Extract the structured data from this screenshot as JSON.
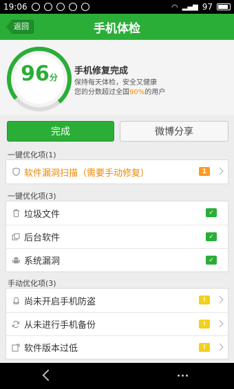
{
  "status_bar": {
    "time": "19:06",
    "battery": "97"
  },
  "title_bar": {
    "back_label": "返回",
    "title": "手机体检"
  },
  "score": {
    "value": "96",
    "unit": "分",
    "fraction": 0.96,
    "headline": "手机修复完成",
    "line1": "保持每天体检，安全又健康",
    "line2_prefix": "您的分数超过全国",
    "line2_pct": "90%",
    "line2_suffix": "的用户"
  },
  "buttons": {
    "done": "完成",
    "share": "微博分享"
  },
  "sections": [
    {
      "title": "一键优化项(1)",
      "items": [
        {
          "label": "软件漏洞扫描（需要手动修复）",
          "icon": "shield-icon",
          "badge": "1",
          "badge_type": "orange",
          "warn": true,
          "chevron": true
        }
      ]
    },
    {
      "title": "一键优化项(3)",
      "items": [
        {
          "label": "垃圾文件",
          "icon": "trash-icon",
          "badge": "✓",
          "badge_type": "check",
          "chevron": false
        },
        {
          "label": "后台软件",
          "icon": "windows-icon",
          "badge": "✓",
          "badge_type": "check",
          "chevron": false
        },
        {
          "label": "系统漏洞",
          "icon": "android-icon",
          "badge": "✓",
          "badge_type": "check",
          "chevron": false
        }
      ]
    },
    {
      "title": "手动优化项(3)",
      "items": [
        {
          "label": "尚未开启手机防盗",
          "icon": "alarm-icon",
          "badge": "!",
          "badge_type": "yellow",
          "chevron": true
        },
        {
          "label": "从未进行手机备份",
          "icon": "sync-icon",
          "badge": "!",
          "badge_type": "yellow",
          "chevron": true
        },
        {
          "label": "软件版本过低",
          "icon": "update-icon",
          "badge": "!",
          "badge_type": "yellow",
          "chevron": true
        }
      ]
    }
  ],
  "colors": {
    "accent": "#2aae37",
    "warn": "#e8890c",
    "orange_badge": "#ff9a1f",
    "yellow_badge": "#f5cf1a"
  }
}
